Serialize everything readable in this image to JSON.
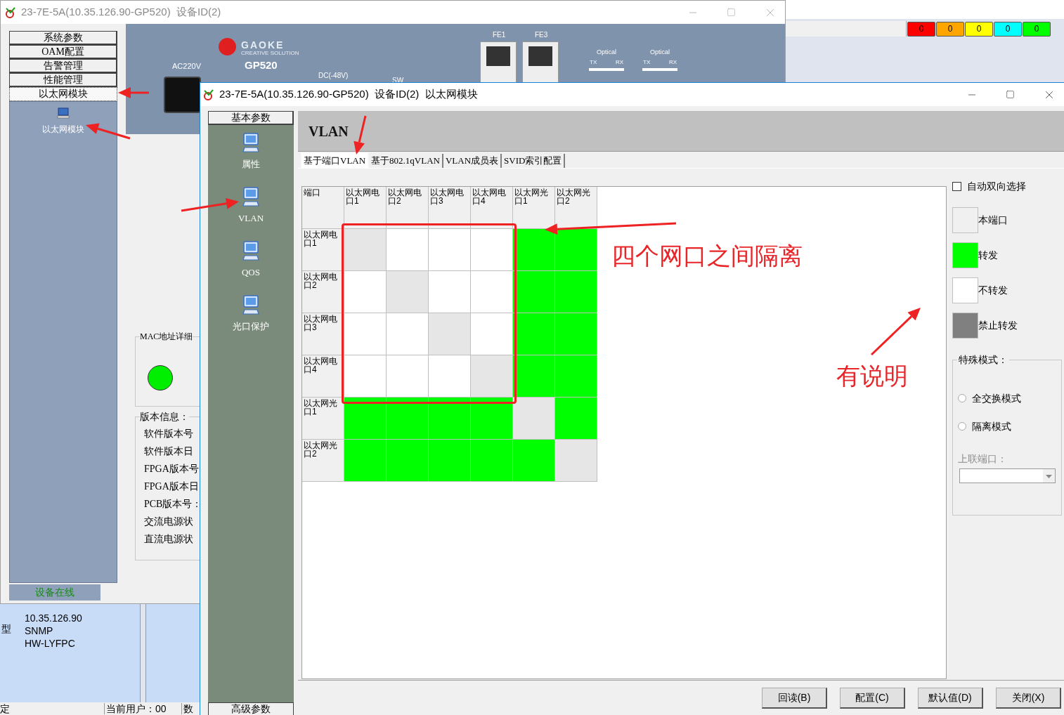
{
  "back_window": {
    "title": "23-7E-5A(10.35.126.90-GP520)  设备ID(2)",
    "nav": [
      {
        "label": "系统参数",
        "selected": false
      },
      {
        "label": "OAM配置",
        "selected": false
      },
      {
        "label": "告警管理",
        "selected": false
      },
      {
        "label": "性能管理",
        "selected": false
      },
      {
        "label": "以太网模块",
        "selected": true
      }
    ],
    "module_item": "以太网模块",
    "status": "设备在线",
    "device_panel": {
      "logo": "GAOKE",
      "slogan": "CREATIVE SOLUTION",
      "model": "GP520",
      "ac": "AC220V",
      "dc": "DC(-48V)",
      "sw": "SW",
      "ports": [
        "FE1",
        "FE3"
      ],
      "optical": [
        {
          "label": "Optical",
          "tx": "TX",
          "rx": "RX"
        },
        {
          "label": "Optical",
          "tx": "TX",
          "rx": "RX"
        }
      ]
    },
    "mac_group": {
      "title": "MAC地址详细",
      "link_up": true
    },
    "version_group": {
      "title": "版本信息：",
      "rows": [
        "软件版本号",
        "软件版本日",
        "FPGA版本号",
        "FPGA版本日",
        "PCB版本号：",
        "交流电源状",
        "直流电源状"
      ]
    }
  },
  "counters": [
    {
      "value": "0",
      "color": "#ff0000"
    },
    {
      "value": "0",
      "color": "#ffa500"
    },
    {
      "value": "0",
      "color": "#ffff00"
    },
    {
      "value": "0",
      "color": "#00ffff"
    },
    {
      "value": "0",
      "color": "#00ff00"
    }
  ],
  "info_panel": {
    "rows": [
      {
        "value": "10.35.126.90"
      },
      {
        "label": "型",
        "value": "SNMP"
      },
      {
        "value": "HW-LYFPC"
      }
    ]
  },
  "status_bar": [
    "定",
    "当前用户：00",
    "数"
  ],
  "front_window": {
    "title": "23-7E-5A(10.35.126.90-GP520)  设备ID(2)  以太网模块",
    "sidebar": {
      "top_button": "基本参数",
      "items": [
        "属性",
        "VLAN",
        "QOS",
        "光口保护"
      ],
      "bottom_button": "高级参数"
    },
    "header": "VLAN",
    "tabs": [
      {
        "label": "基于端口VLAN",
        "selected": true
      },
      {
        "label": "基于802.1qVLAN",
        "selected": false
      },
      {
        "label": "VLAN成员表",
        "selected": false
      },
      {
        "label": "SVID索引配置",
        "selected": false
      }
    ],
    "matrix": {
      "corner": "端口",
      "columns": [
        "以太网电口1",
        "以太网电口2",
        "以太网电口3",
        "以太网电口4",
        "以太网光口1",
        "以太网光口2"
      ],
      "rows": [
        {
          "label": "以太网电口1",
          "cells": [
            {
              "own": true
            },
            {
              "own": false,
              "forward": false
            },
            {
              "own": false,
              "forward": false
            },
            {
              "own": false,
              "forward": false
            },
            {
              "own": false,
              "forward": true
            },
            {
              "own": false,
              "forward": true
            }
          ]
        },
        {
          "label": "以太网电口2",
          "cells": [
            {
              "own": false,
              "forward": false
            },
            {
              "own": true
            },
            {
              "own": false,
              "forward": false
            },
            {
              "own": false,
              "forward": false
            },
            {
              "own": false,
              "forward": true
            },
            {
              "own": false,
              "forward": true
            }
          ]
        },
        {
          "label": "以太网电口3",
          "cells": [
            {
              "own": false,
              "forward": false
            },
            {
              "own": false,
              "forward": false
            },
            {
              "own": true
            },
            {
              "own": false,
              "forward": false
            },
            {
              "own": false,
              "forward": true
            },
            {
              "own": false,
              "forward": true
            }
          ]
        },
        {
          "label": "以太网电口4",
          "cells": [
            {
              "own": false,
              "forward": false
            },
            {
              "own": false,
              "forward": false
            },
            {
              "own": false,
              "forward": false
            },
            {
              "own": true
            },
            {
              "own": false,
              "forward": true
            },
            {
              "own": false,
              "forward": true
            }
          ]
        },
        {
          "label": "以太网光口1",
          "cells": [
            {
              "own": false,
              "forward": true
            },
            {
              "own": false,
              "forward": true
            },
            {
              "own": false,
              "forward": true
            },
            {
              "own": false,
              "forward": true
            },
            {
              "own": true
            },
            {
              "own": false,
              "forward": true
            }
          ]
        },
        {
          "label": "以太网光口2",
          "cells": [
            {
              "own": false,
              "forward": true
            },
            {
              "own": false,
              "forward": true
            },
            {
              "own": false,
              "forward": true
            },
            {
              "own": false,
              "forward": true
            },
            {
              "own": false,
              "forward": true
            },
            {
              "own": true
            }
          ]
        }
      ]
    },
    "auto_bidirectional": {
      "label": "自动双向选择",
      "checked": false
    },
    "legend": [
      {
        "kind": "self",
        "label": "本端口"
      },
      {
        "kind": "forward",
        "label": "转发"
      },
      {
        "kind": "none",
        "label": "不转发"
      },
      {
        "kind": "forbid",
        "label": "禁止转发"
      }
    ],
    "special_mode": {
      "title": "特殊模式：",
      "options": [
        {
          "label": "全交换模式",
          "selected": false
        },
        {
          "label": "隔离模式",
          "selected": false
        }
      ],
      "uplink_label": "上联端口：",
      "uplink_disabled": true
    },
    "buttons": [
      "回读(B)",
      "配置(C)",
      "默认值(D)",
      "关闭(X)"
    ]
  },
  "annotations": [
    "四个网口之间隔离",
    "有说明"
  ]
}
